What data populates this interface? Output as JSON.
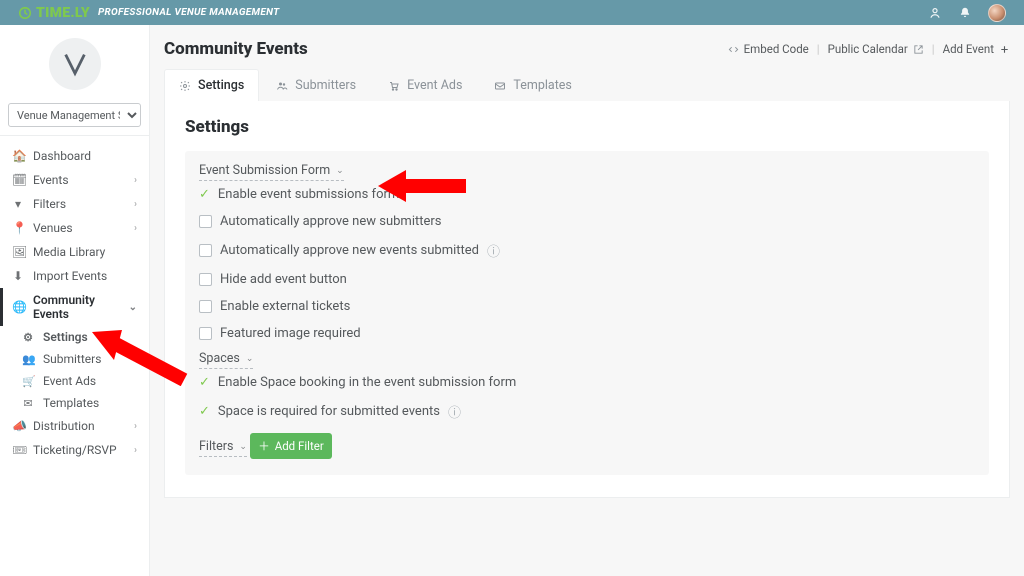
{
  "brand": {
    "name": "TIME.LY",
    "tag": "PROFESSIONAL VENUE MANAGEMENT"
  },
  "selector": {
    "value": "Venue Management Software"
  },
  "nav": {
    "dashboard": "Dashboard",
    "events": "Events",
    "filters": "Filters",
    "venues": "Venues",
    "media": "Media Library",
    "import": "Import Events",
    "community": "Community Events",
    "community_sub": {
      "settings": "Settings",
      "submitters": "Submitters",
      "eventads": "Event Ads",
      "templates": "Templates"
    },
    "distribution": "Distribution",
    "ticketing": "Ticketing/RSVP"
  },
  "page": {
    "title": "Community Events",
    "actions": {
      "embed": "Embed Code",
      "public": "Public Calendar",
      "add": "Add Event"
    }
  },
  "tabs": {
    "settings": "Settings",
    "submitters": "Submitters",
    "eventads": "Event Ads",
    "templates": "Templates"
  },
  "settings": {
    "heading": "Settings",
    "sections": {
      "form": "Event Submission Form",
      "spaces": "Spaces",
      "filters": "Filters"
    },
    "opts": {
      "enable_form": "Enable event submissions form",
      "auto_submitters": "Automatically approve new submitters",
      "auto_events": "Automatically approve new events submitted",
      "hide_add": "Hide add event button",
      "external_tickets": "Enable external tickets",
      "featured_required": "Featured image required",
      "enable_space_booking": "Enable Space booking in the event submission form",
      "space_required": "Space is required for submitted events"
    },
    "add_filter": "Add Filter"
  }
}
